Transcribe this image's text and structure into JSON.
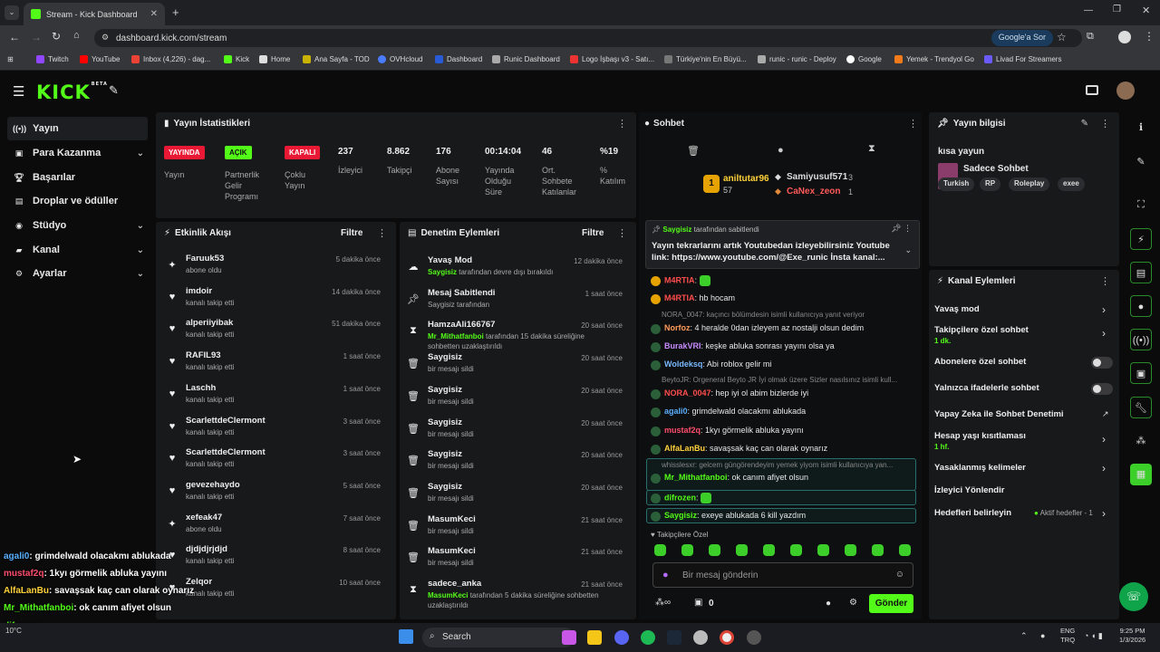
{
  "browser": {
    "tab_title": "Stream - Kick Dashboard",
    "url": "dashboard.kick.com/stream",
    "google_btn": "Google'a Sor",
    "bookmarks": [
      "Twitch",
      "YouTube",
      "Inbox (4,226) - dag...",
      "Kick",
      "Home",
      "Ana Sayfa - TOD",
      "OVHcloud",
      "Dashboard",
      "Runic Dashboard",
      "Logo İşbaşı v3 - Satı...",
      "Türkiye'nin En Büyü...",
      "runic - runic - Deploy",
      "Google",
      "Yemek - Trendyol Go",
      "Livad For Streamers"
    ]
  },
  "header": {
    "logo": "KICK",
    "beta": "BETA"
  },
  "sidebar": [
    {
      "label": "Yayın",
      "icon": "broadcast-icon"
    },
    {
      "label": "Para Kazanma",
      "icon": "money-icon"
    },
    {
      "label": "Başarılar",
      "icon": "trophy-icon"
    },
    {
      "label": "Droplar ve ödüller",
      "icon": "gift-icon"
    },
    {
      "label": "Stüdyo",
      "icon": "studio-icon"
    },
    {
      "label": "Kanal",
      "icon": "channel-icon"
    },
    {
      "label": "Ayarlar",
      "icon": "gear-icon"
    }
  ],
  "stats": {
    "title": "Yayın İstatistikleri",
    "badges": [
      {
        "text": "YAYINDA",
        "label": "Yayın"
      },
      {
        "text": "AÇIK",
        "label": "Partnerlik Gelir Programı"
      },
      {
        "text": "KAPALI",
        "label": "Çoklu Yayın"
      }
    ],
    "items": [
      {
        "value": "237",
        "label": "İzleyici"
      },
      {
        "value": "8.862",
        "label": "Takipçi"
      },
      {
        "value": "176",
        "label": "Abone Sayısı"
      },
      {
        "value": "00:14:04",
        "label": "Yayında Olduğu Süre"
      },
      {
        "value": "46",
        "label": "Ort. Sohbete Katılanlar"
      },
      {
        "value": "%19",
        "label": "% Katılım"
      }
    ]
  },
  "activity": {
    "title": "Etkinlik Akışı",
    "filter": "Filtre",
    "rows": [
      {
        "name": "Faruuk53",
        "sub": "abone oldu",
        "time": "5 dakika önce",
        "type": "sub"
      },
      {
        "name": "imdoir",
        "sub": "kanalı takip etti",
        "time": "14 dakika önce",
        "type": "follow"
      },
      {
        "name": "alperiiyibak",
        "sub": "kanalı takip etti",
        "time": "51 dakika önce",
        "type": "follow"
      },
      {
        "name": "RAFIL93",
        "sub": "kanalı takip etti",
        "time": "1 saat önce",
        "type": "follow"
      },
      {
        "name": "Laschh",
        "sub": "kanalı takip etti",
        "time": "1 saat önce",
        "type": "follow"
      },
      {
        "name": "ScarlettdeClermont",
        "sub": "kanalı takip etti",
        "time": "3 saat önce",
        "type": "follow"
      },
      {
        "name": "ScarlettdeClermont",
        "sub": "kanalı takip etti",
        "time": "3 saat önce",
        "type": "follow"
      },
      {
        "name": "gevezehaydo",
        "sub": "kanalı takip etti",
        "time": "5 saat önce",
        "type": "follow"
      },
      {
        "name": "xefeak47",
        "sub": "abone oldu",
        "time": "7 saat önce",
        "type": "sub"
      },
      {
        "name": "djdjdjrjdjd",
        "sub": "kanalı takip etti",
        "time": "8 saat önce",
        "type": "follow"
      },
      {
        "name": "Zelqor",
        "sub": "kanalı takip etti",
        "time": "10 saat önce",
        "type": "follow"
      }
    ]
  },
  "moderation": {
    "title": "Denetim Eylemleri",
    "filter": "Filtre",
    "rows": [
      {
        "name": "Yavaş Mod",
        "user": "Saygisiz",
        "sub": "tarafından devre dışı bırakıldı",
        "time": "12 dakika önce",
        "icon": "slowmode-icon"
      },
      {
        "name": "Mesaj Sabitlendi",
        "user": "",
        "sub": "Saygisiz tarafından",
        "time": "1 saat önce",
        "icon": "pin-icon"
      },
      {
        "name": "HamzaAli166767",
        "user": "Mr_Mithatfanboi",
        "sub": "tarafından 15 dakika süreliğine sohbetten uzaklaştırıldı",
        "time": "20 saat önce",
        "icon": "timeout-icon"
      },
      {
        "name": "Saygisiz",
        "user": "",
        "sub": "bir mesajı sildi",
        "time": "20 saat önce",
        "icon": "trash-icon"
      },
      {
        "name": "Saygisiz",
        "user": "",
        "sub": "bir mesajı sildi",
        "time": "20 saat önce",
        "icon": "trash-icon"
      },
      {
        "name": "Saygisiz",
        "user": "",
        "sub": "bir mesajı sildi",
        "time": "20 saat önce",
        "icon": "trash-icon"
      },
      {
        "name": "Saygisiz",
        "user": "",
        "sub": "bir mesajı sildi",
        "time": "20 saat önce",
        "icon": "trash-icon"
      },
      {
        "name": "Saygisiz",
        "user": "",
        "sub": "bir mesajı sildi",
        "time": "20 saat önce",
        "icon": "trash-icon"
      },
      {
        "name": "MasumKeci",
        "user": "",
        "sub": "bir mesajı sildi",
        "time": "21 saat önce",
        "icon": "trash-icon"
      },
      {
        "name": "MasumKeci",
        "user": "",
        "sub": "bir mesajı sildi",
        "time": "21 saat önce",
        "icon": "trash-icon"
      },
      {
        "name": "sadece_anka",
        "user": "MasumKeci",
        "sub": "tarafından 5 dakika süreliğine sohbetten uzaklaştırıldı",
        "time": "21 saat önce",
        "icon": "timeout-icon"
      }
    ]
  },
  "chat": {
    "title": "Sohbet",
    "leaders": [
      {
        "rank": "1",
        "name": "aniltutar96",
        "value": "57"
      },
      {
        "rank": "2",
        "name": "Samiyusuf571",
        "value": "3"
      },
      {
        "rank": "3",
        "name": "CaNex_zeon",
        "value": "1"
      }
    ],
    "pinned": {
      "by": "Saygisiz",
      "by_suffix": "tarafından sabitlendi",
      "text": "Yayın tekrarlarını artık Youtubedan izleyebilirsiniz Youtube link: https://www.youtube.com/@Exe_runic İnsta kanal:..."
    },
    "messages": [
      {
        "user": "M4RTIA",
        "text": "",
        "color": "#ff4d4d",
        "reply": ""
      },
      {
        "user": "M4RTIA",
        "text": "hb hocam",
        "color": "#ff4d4d",
        "reply": ""
      },
      {
        "user": "Norfoz",
        "text": "4 heralde 0dan izleyem az nostalji olsun dedim",
        "color": "#ff9b5b",
        "reply": "NORA_0047: kaçıncı bölümdesin isimli kullanıcıya yanıt veriyor"
      },
      {
        "user": "BurakVRI",
        "text": "keşke abluka sonrası yayını olsa ya",
        "color": "#c88bff",
        "reply": ""
      },
      {
        "user": "Woldeksq",
        "text": "Abi roblox gelir mi",
        "color": "#7ab8ff",
        "reply": ""
      },
      {
        "user": "NORA_0047",
        "text": "hep iyi ol abim bizlerde iyi",
        "color": "#ff4d4d",
        "reply": "BeytoJR: Orgeneral Beyto JR İyi olmak üzere Sizler nasılsınız isimli kull..."
      },
      {
        "user": "agali0",
        "text": "grimdelwald olacakmı ablukada",
        "color": "#5ab0ff",
        "reply": ""
      },
      {
        "user": "mustaf2q",
        "text": "1kyı görmelik abluka yayını",
        "color": "#ff4d6d",
        "reply": ""
      },
      {
        "user": "AlfaLanBu",
        "text": "savaşsak kaç can olarak oynarız",
        "color": "#ffd23a",
        "reply": ""
      },
      {
        "user": "Mr_Mithatfanboi",
        "text": "ok canım afiyet olsun",
        "color": "#53fc18",
        "reply": "whisslesxr: gelcem güngörendeyim yemek yiyom isimli kullanıcıya yan..."
      },
      {
        "user": "difrozen",
        "text": "",
        "color": "#53fc18",
        "reply": ""
      },
      {
        "user": "Saygisiz",
        "text": "exeye ablukada 6 kill yazdım",
        "color": "#53fc18",
        "reply": ""
      }
    ],
    "emote_label": "Takipçilere Özel",
    "input_placeholder": "Bir mesaj gönderin",
    "send": "Gönder",
    "points": "0"
  },
  "stream_info": {
    "title": "Yayın bilgisi",
    "stream_title": "kısa yayun",
    "category": "Sadece Sohbet",
    "tags": [
      "Turkish",
      "RP",
      "Roleplay",
      "exee"
    ]
  },
  "channel_actions": {
    "title": "Kanal Eylemleri",
    "items": [
      {
        "label": "Yavaş mod",
        "sub": "",
        "kind": "arrow"
      },
      {
        "label": "Takipçilere özel sohbet",
        "sub": "1 dk.",
        "kind": "arrow"
      },
      {
        "label": "Abonelere özel sohbet",
        "sub": "",
        "kind": "toggle"
      },
      {
        "label": "Yalnızca ifadelerle sohbet",
        "sub": "",
        "kind": "toggle"
      },
      {
        "label": "Yapay Zeka ile Sohbet Denetimi",
        "sub": "",
        "kind": "ext"
      },
      {
        "label": "Hesap yaşı kısıtlaması",
        "sub": "1 hf.",
        "kind": "arrow"
      },
      {
        "label": "Yasaklanmış kelimeler",
        "sub": "",
        "kind": "arrow"
      },
      {
        "label": "İzleyici Yönlendir",
        "sub": "",
        "kind": "none"
      },
      {
        "label": "Hedefleri belirleyin",
        "sub": "",
        "kind": "goal",
        "extra": "Aktif hedefler - 1"
      }
    ]
  },
  "overlay": [
    {
      "user": "agali0",
      "text": ": grimdelwald olacakmı ablukada",
      "color": "#5ab0ff"
    },
    {
      "user": "mustaf2q",
      "text": ": 1kyı görmelik abluka yayını",
      "color": "#ff4d6d"
    },
    {
      "user": "AlfaLanBu",
      "text": ": savaşsak kaç can olarak oynarız",
      "color": "#ffd23a"
    },
    {
      "user": "Mr_Mithatfanboi",
      "text": ": ok canım afiyet olsun",
      "color": "#53fc18"
    },
    {
      "user": "difrozen",
      "text": ":",
      "color": "#53fc18"
    },
    {
      "user": "Saygisiz",
      "text": ": exeye ablukada 6 kill yazdım",
      "color": "#53fc18"
    }
  ],
  "taskbar": {
    "search": "Search",
    "weather": "10°C",
    "lang1": "ENG",
    "lang2": "TRQ",
    "time": "9:25 PM",
    "date": "1/3/2026"
  }
}
